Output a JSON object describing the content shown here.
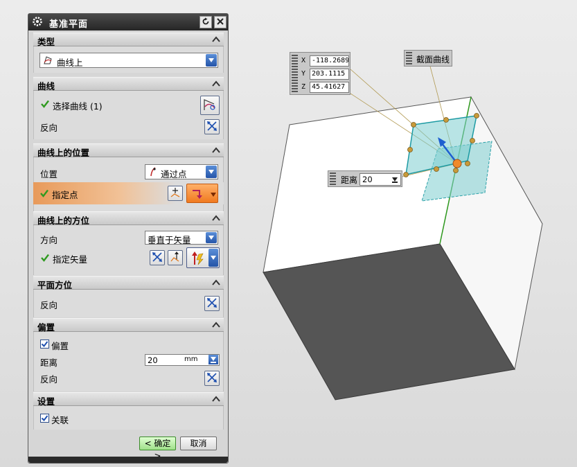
{
  "dialog": {
    "title": "基准平面",
    "ok_label": "< 确定 >",
    "cancel_label": "取消"
  },
  "sections": {
    "type": {
      "header": "类型",
      "value": "曲线上"
    },
    "curve": {
      "header": "曲线",
      "select_label": "选择曲线 (1)",
      "reverse_label": "反向"
    },
    "position": {
      "header": "曲线上的位置",
      "pos_label": "位置",
      "pos_value": "通过点",
      "point_label": "指定点"
    },
    "orientation": {
      "header": "曲线上的方位",
      "dir_label": "方向",
      "dir_value": "垂直于矢量",
      "vector_label": "指定矢量"
    },
    "plane": {
      "header": "平面方位",
      "reverse_label": "反向"
    },
    "offset": {
      "header": "偏置",
      "offset_label": "偏置",
      "offset_checked": true,
      "dist_label": "距离",
      "dist_value": "20",
      "dist_unit": "mm",
      "reverse_label": "反向"
    },
    "settings": {
      "header": "设置",
      "assoc_label": "关联",
      "assoc_checked": true
    }
  },
  "viewport": {
    "coords": {
      "x_axis": "X",
      "x_value": "-118.2689",
      "y_axis": "Y",
      "y_value": "203.1115",
      "z_axis": "Z",
      "z_value": "45.41627"
    },
    "section_curve_tag": "截面曲线",
    "distance_tag": {
      "label": "距离",
      "value": "20"
    }
  },
  "colors": {
    "accent_green": "#2f9a1f",
    "accent_orange": "#f08a2c",
    "plane_cyan": "#7ecdd0",
    "dark_face": "#555555"
  }
}
